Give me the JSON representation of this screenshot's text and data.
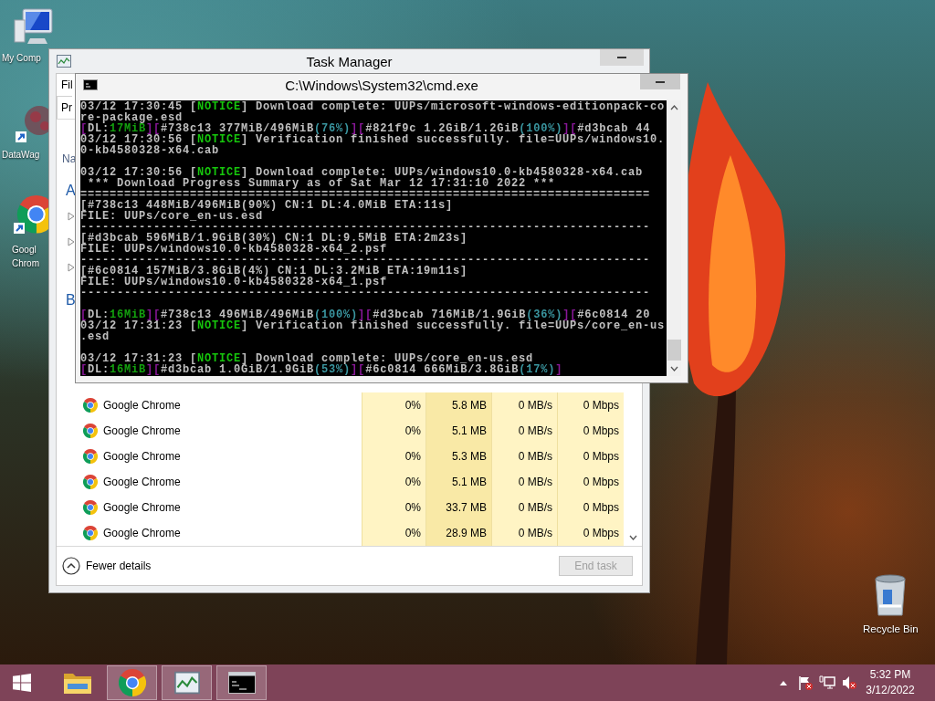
{
  "desktop_icons": [
    {
      "kind": "computer",
      "label_lines": [
        "My Comp"
      ]
    },
    {
      "kind": "shortcut",
      "label_lines": [
        "DataWag"
      ]
    },
    {
      "kind": "chrome",
      "label_lines": [
        "Googl",
        "Chrom"
      ]
    },
    {
      "kind": "recycle-bin",
      "label_lines": [
        "Recycle Bin"
      ]
    }
  ],
  "task_manager": {
    "title": "Task Manager",
    "menu_item": "Fil",
    "tab": {
      "label": "Pr",
      "selected": true
    },
    "column_header": "Na",
    "list_items": [
      {
        "kind": "group",
        "label": "A"
      },
      {
        "kind": "expander",
        "expanded": false
      },
      {
        "kind": "expander",
        "expanded": false
      },
      {
        "kind": "expander",
        "expanded": false
      },
      {
        "kind": "group",
        "label": "B"
      }
    ],
    "rows": [
      {
        "name": "Google Chrome",
        "cells": [
          "0%",
          "5.8 MB",
          "0 MB/s",
          "0 Mbps"
        ]
      },
      {
        "name": "Google Chrome",
        "cells": [
          "0%",
          "5.1 MB",
          "0 MB/s",
          "0 Mbps"
        ]
      },
      {
        "name": "Google Chrome",
        "cells": [
          "0%",
          "5.3 MB",
          "0 MB/s",
          "0 Mbps"
        ]
      },
      {
        "name": "Google Chrome",
        "cells": [
          "0%",
          "5.1 MB",
          "0 MB/s",
          "0 Mbps"
        ]
      },
      {
        "name": "Google Chrome",
        "cells": [
          "0%",
          "33.7 MB",
          "0 MB/s",
          "0 Mbps"
        ]
      },
      {
        "name": "Google Chrome",
        "cells": [
          "0%",
          "28.9 MB",
          "0 MB/s",
          "0 Mbps"
        ]
      }
    ],
    "footer": {
      "toggle": "Fewer details",
      "end_task": {
        "label": "End task",
        "disabled": true
      }
    }
  },
  "cmd_window": {
    "title": "C:\\Windows\\System32\\cmd.exe",
    "lines": [
      {
        "kind": "text",
        "segments": [
          {
            "text": "03/12 17:30:45 [",
            "kind": "plain"
          },
          {
            "text": "NOTICE",
            "kind": "notice"
          },
          {
            "text": "] Download complete: UUPs/microsoft-windows-editionpack-co",
            "kind": "plain"
          }
        ]
      },
      {
        "kind": "text",
        "segments": [
          {
            "text": "re-package.esd",
            "kind": "plain"
          }
        ]
      },
      {
        "kind": "text",
        "segments": [
          {
            "text": "[",
            "kind": "bracket"
          },
          {
            "text": "DL:",
            "kind": "plain"
          },
          {
            "text": "17MiB",
            "kind": "speed"
          },
          {
            "text": "][",
            "kind": "bracket"
          },
          {
            "text": "#738c13 377MiB/496MiB",
            "kind": "plain"
          },
          {
            "text": "(76%)",
            "kind": "percent"
          },
          {
            "text": "][",
            "kind": "bracket"
          },
          {
            "text": "#821f9c 1.2GiB/1.2GiB",
            "kind": "plain"
          },
          {
            "text": "(100%)",
            "kind": "percent"
          },
          {
            "text": "][",
            "kind": "bracket"
          },
          {
            "text": "#d3bcab 44",
            "kind": "plain"
          }
        ]
      },
      {
        "kind": "text",
        "segments": [
          {
            "text": "03/12 17:30:56 [",
            "kind": "plain"
          },
          {
            "text": "NOTICE",
            "kind": "notice"
          },
          {
            "text": "] Verification finished successfully. file=UUPs/windows10.",
            "kind": "plain"
          }
        ]
      },
      {
        "kind": "text",
        "segments": [
          {
            "text": "0-kb4580328-x64.cab",
            "kind": "plain"
          }
        ]
      },
      {
        "kind": "blank"
      },
      {
        "kind": "text",
        "segments": [
          {
            "text": "03/12 17:30:56 [",
            "kind": "plain"
          },
          {
            "text": "NOTICE",
            "kind": "notice"
          },
          {
            "text": "] Download complete: UUPs/windows10.0-kb4580328-x64.cab",
            "kind": "plain"
          }
        ]
      },
      {
        "kind": "text",
        "segments": [
          {
            "text": " *** Download Progress Summary as of Sat Mar 12 17:31:10 2022 ***",
            "kind": "plain"
          }
        ]
      },
      {
        "kind": "text",
        "segments": [
          {
            "text": "==============================================================================",
            "kind": "plain"
          }
        ]
      },
      {
        "kind": "text",
        "segments": [
          {
            "text": "[#738c13 448MiB/496MiB(90%) CN:1 DL:4.0MiB ETA:11s]",
            "kind": "plain"
          }
        ]
      },
      {
        "kind": "text",
        "segments": [
          {
            "text": "FILE: UUPs/core_en-us.esd",
            "kind": "plain"
          }
        ]
      },
      {
        "kind": "text",
        "segments": [
          {
            "text": "------------------------------------------------------------------------------",
            "kind": "plain"
          }
        ]
      },
      {
        "kind": "text",
        "segments": [
          {
            "text": "[#d3bcab 596MiB/1.9GiB(30%) CN:1 DL:9.5MiB ETA:2m23s]",
            "kind": "plain"
          }
        ]
      },
      {
        "kind": "text",
        "segments": [
          {
            "text": "FILE: UUPs/windows10.0-kb4580328-x64_2.psf",
            "kind": "plain"
          }
        ]
      },
      {
        "kind": "text",
        "segments": [
          {
            "text": "------------------------------------------------------------------------------",
            "kind": "plain"
          }
        ]
      },
      {
        "kind": "text",
        "segments": [
          {
            "text": "[#6c0814 157MiB/3.8GiB(4%) CN:1 DL:3.2MiB ETA:19m11s]",
            "kind": "plain"
          }
        ]
      },
      {
        "kind": "text",
        "segments": [
          {
            "text": "FILE: UUPs/windows10.0-kb4580328-x64_1.psf",
            "kind": "plain"
          }
        ]
      },
      {
        "kind": "text",
        "segments": [
          {
            "text": "------------------------------------------------------------------------------",
            "kind": "plain"
          }
        ]
      },
      {
        "kind": "blank"
      },
      {
        "kind": "text",
        "segments": [
          {
            "text": "[",
            "kind": "bracket"
          },
          {
            "text": "DL:",
            "kind": "plain"
          },
          {
            "text": "16MiB",
            "kind": "speed"
          },
          {
            "text": "][",
            "kind": "bracket"
          },
          {
            "text": "#738c13 496MiB/496MiB",
            "kind": "plain"
          },
          {
            "text": "(100%)",
            "kind": "percent"
          },
          {
            "text": "][",
            "kind": "bracket"
          },
          {
            "text": "#d3bcab 716MiB/1.9GiB",
            "kind": "plain"
          },
          {
            "text": "(36%)",
            "kind": "percent"
          },
          {
            "text": "][",
            "kind": "bracket"
          },
          {
            "text": "#6c0814 20",
            "kind": "plain"
          }
        ]
      },
      {
        "kind": "text",
        "segments": [
          {
            "text": "03/12 17:31:23 [",
            "kind": "plain"
          },
          {
            "text": "NOTICE",
            "kind": "notice"
          },
          {
            "text": "] Verification finished successfully. file=UUPs/core_en-us",
            "kind": "plain"
          }
        ]
      },
      {
        "kind": "text",
        "segments": [
          {
            "text": ".esd",
            "kind": "plain"
          }
        ]
      },
      {
        "kind": "blank"
      },
      {
        "kind": "text",
        "segments": [
          {
            "text": "03/12 17:31:23 [",
            "kind": "plain"
          },
          {
            "text": "NOTICE",
            "kind": "notice"
          },
          {
            "text": "] Download complete: UUPs/core_en-us.esd",
            "kind": "plain"
          }
        ]
      },
      {
        "kind": "text",
        "segments": [
          {
            "text": "[",
            "kind": "bracket"
          },
          {
            "text": "DL:",
            "kind": "plain"
          },
          {
            "text": "16MiB",
            "kind": "speed"
          },
          {
            "text": "][",
            "kind": "bracket"
          },
          {
            "text": "#d3bcab 1.0GiB/1.9GiB",
            "kind": "plain"
          },
          {
            "text": "(53%)",
            "kind": "percent"
          },
          {
            "text": "][",
            "kind": "bracket"
          },
          {
            "text": "#6c0814 666MiB/3.8GiB",
            "kind": "plain"
          },
          {
            "text": "(17%)",
            "kind": "percent"
          },
          {
            "text": "]",
            "kind": "bracket"
          }
        ]
      }
    ]
  },
  "taskbar": {
    "buttons": [
      {
        "kind": "explorer",
        "running": false
      },
      {
        "kind": "chrome",
        "running": true
      },
      {
        "kind": "task-manager",
        "running": true
      },
      {
        "kind": "console",
        "running": true
      }
    ],
    "clock": {
      "time": "5:32 PM",
      "date": "3/12/2022"
    }
  }
}
